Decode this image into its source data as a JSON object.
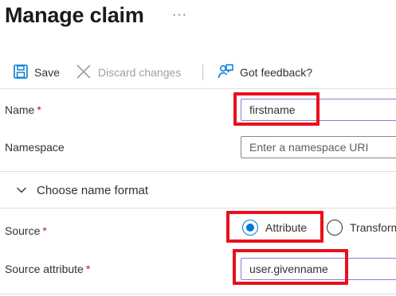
{
  "header": {
    "title": "Manage claim",
    "more_label": "···"
  },
  "toolbar": {
    "save_label": "Save",
    "discard_label": "Discard changes",
    "feedback_label": "Got feedback?"
  },
  "form": {
    "name": {
      "label": "Name",
      "required_mark": "*",
      "value": "firstname"
    },
    "namespace": {
      "label": "Namespace",
      "placeholder": "Enter a namespace URI"
    },
    "name_format": {
      "label": "Choose name format",
      "expanded": false
    },
    "source": {
      "label": "Source",
      "required_mark": "*",
      "options": [
        {
          "label": "Attribute",
          "selected": true
        },
        {
          "label": "Transform",
          "selected": false
        }
      ]
    },
    "source_attribute": {
      "label": "Source attribute",
      "required_mark": "*",
      "value": "user.givenname"
    }
  },
  "colors": {
    "accent": "#0078d4",
    "highlight": "#e8101a",
    "required": "#a4262c",
    "disabled_text": "#a19f9d"
  },
  "icons": [
    "save-icon",
    "close-icon",
    "feedback-icon",
    "chevron-down-icon"
  ]
}
